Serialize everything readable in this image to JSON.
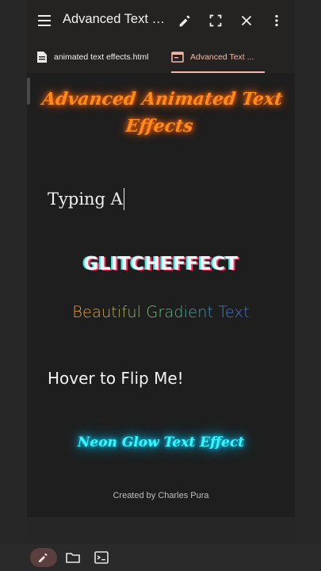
{
  "appbar": {
    "title": "Advanced Text Effects",
    "icons": [
      "menu-icon",
      "pencil-icon",
      "fullscreen-icon",
      "close-icon",
      "more-vert-icon"
    ]
  },
  "tabs": [
    {
      "label": "animated text effects.html",
      "icon": "file-icon",
      "active": false
    },
    {
      "label": "Advanced Text ...",
      "icon": "browser-icon",
      "active": true
    }
  ],
  "content": {
    "heading": "Advanced Animated Text Effects",
    "typing_text": "Typing A",
    "glitch_text": "GLITCHEFFECT",
    "gradient_words": [
      "Beautiful",
      "Gradient",
      "Text"
    ],
    "flip_text": "Hover to Flip Me!",
    "neon_text": "Neon Glow Text Effect",
    "credit": "Created by Charles Pura"
  },
  "bottombar": {
    "icons": [
      "edit-icon",
      "folder-icon",
      "terminal-icon"
    ]
  },
  "colors": {
    "accent": "#f2b7a6",
    "heading_orange": "#ff8a1e",
    "neon_cyan": "#3ff4ff"
  }
}
